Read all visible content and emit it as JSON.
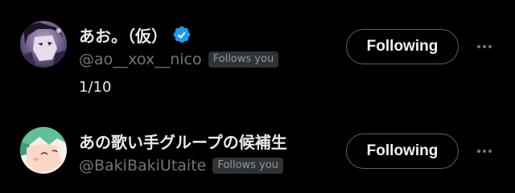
{
  "users": [
    {
      "display_name": "あお。（仮）",
      "verified": true,
      "handle": "@ao__xox__nico",
      "follows_you_label": "Follows you",
      "bio": "1/10",
      "follow_button_label": "Following",
      "more_icon": "more-horizontal-icon"
    },
    {
      "display_name": "あの歌い手グループの候補生",
      "verified": false,
      "handle": "@BakiBakiUtaite",
      "follows_you_label": "Follows you",
      "bio": "",
      "follow_button_label": "Following",
      "more_icon": "more-horizontal-icon"
    }
  ],
  "colors": {
    "background": "#000000",
    "primary_text": "#e7e9ea",
    "secondary_text": "#71767b",
    "badge_bg": "#2f3336",
    "verified_blue": "#1d9bf0",
    "button_border": "#536471"
  }
}
